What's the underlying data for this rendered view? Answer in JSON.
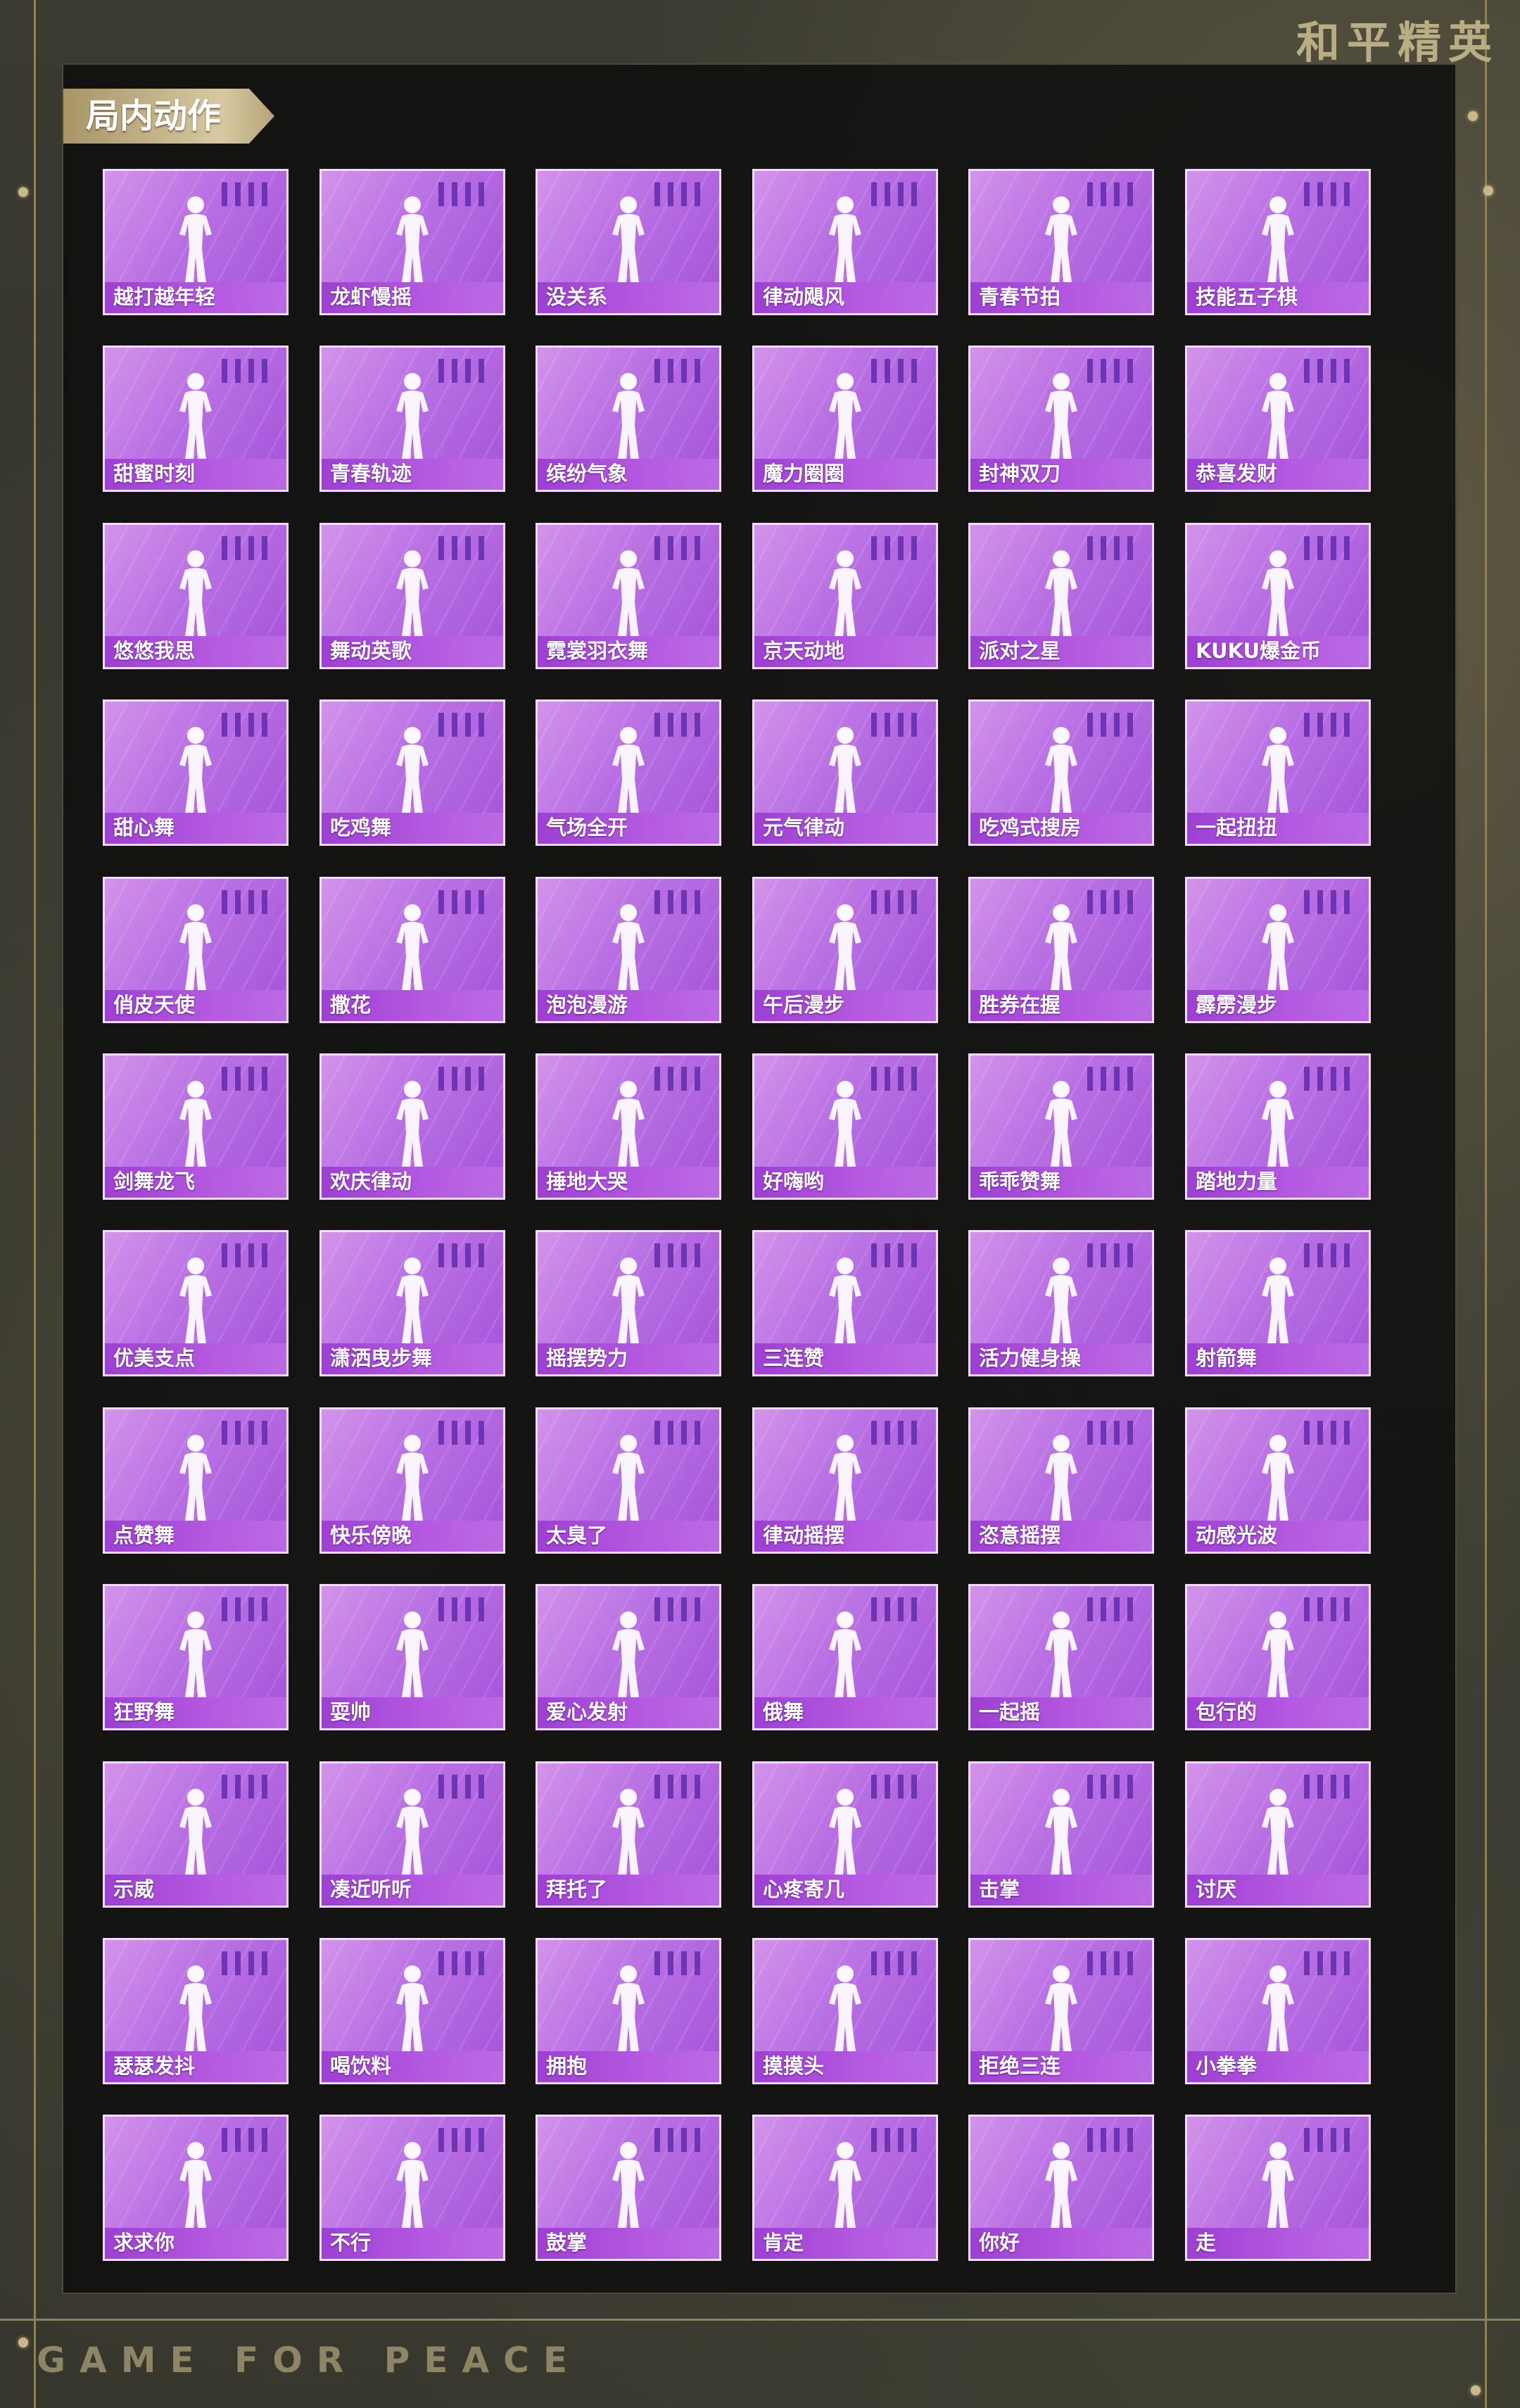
{
  "header": {
    "brand": "和平精英"
  },
  "section": {
    "title": "局内动作"
  },
  "footer": {
    "text": "GAME FOR PEACE"
  },
  "emotes": [
    "越打越年轻",
    "龙虾慢摇",
    "没关系",
    "律动飓风",
    "青春节拍",
    "技能五子棋",
    "甜蜜时刻",
    "青春轨迹",
    "缤纷气象",
    "魔力圈圈",
    "封神双刀",
    "恭喜发财",
    "悠悠我思",
    "舞动英歌",
    "霓裳羽衣舞",
    "京天动地",
    "派对之星",
    "KUKU爆金币",
    "甜心舞",
    "吃鸡舞",
    "气场全开",
    "元气律动",
    "吃鸡式搜房",
    "一起扭扭",
    "俏皮天使",
    "撒花",
    "泡泡漫游",
    "午后漫步",
    "胜券在握",
    "霹雳漫步",
    "剑舞龙飞",
    "欢庆律动",
    "捶地大哭",
    "好嗨哟",
    "乖乖赞舞",
    "踏地力量",
    "优美支点",
    "潇洒曳步舞",
    "摇摆势力",
    "三连赞",
    "活力健身操",
    "射箭舞",
    "点赞舞",
    "快乐傍晚",
    "太臭了",
    "律动摇摆",
    "恣意摇摆",
    "动感光波",
    "狂野舞",
    "耍帅",
    "爱心发射",
    "俄舞",
    "一起摇",
    "包行的",
    "示威",
    "凑近听听",
    "拜托了",
    "心疼寄几",
    "击掌",
    "讨厌",
    "瑟瑟发抖",
    "喝饮料",
    "拥抱",
    "摸摸头",
    "拒绝三连",
    "小拳拳",
    "求求你",
    "不行",
    "鼓掌",
    "肯定",
    "你好",
    "走"
  ]
}
